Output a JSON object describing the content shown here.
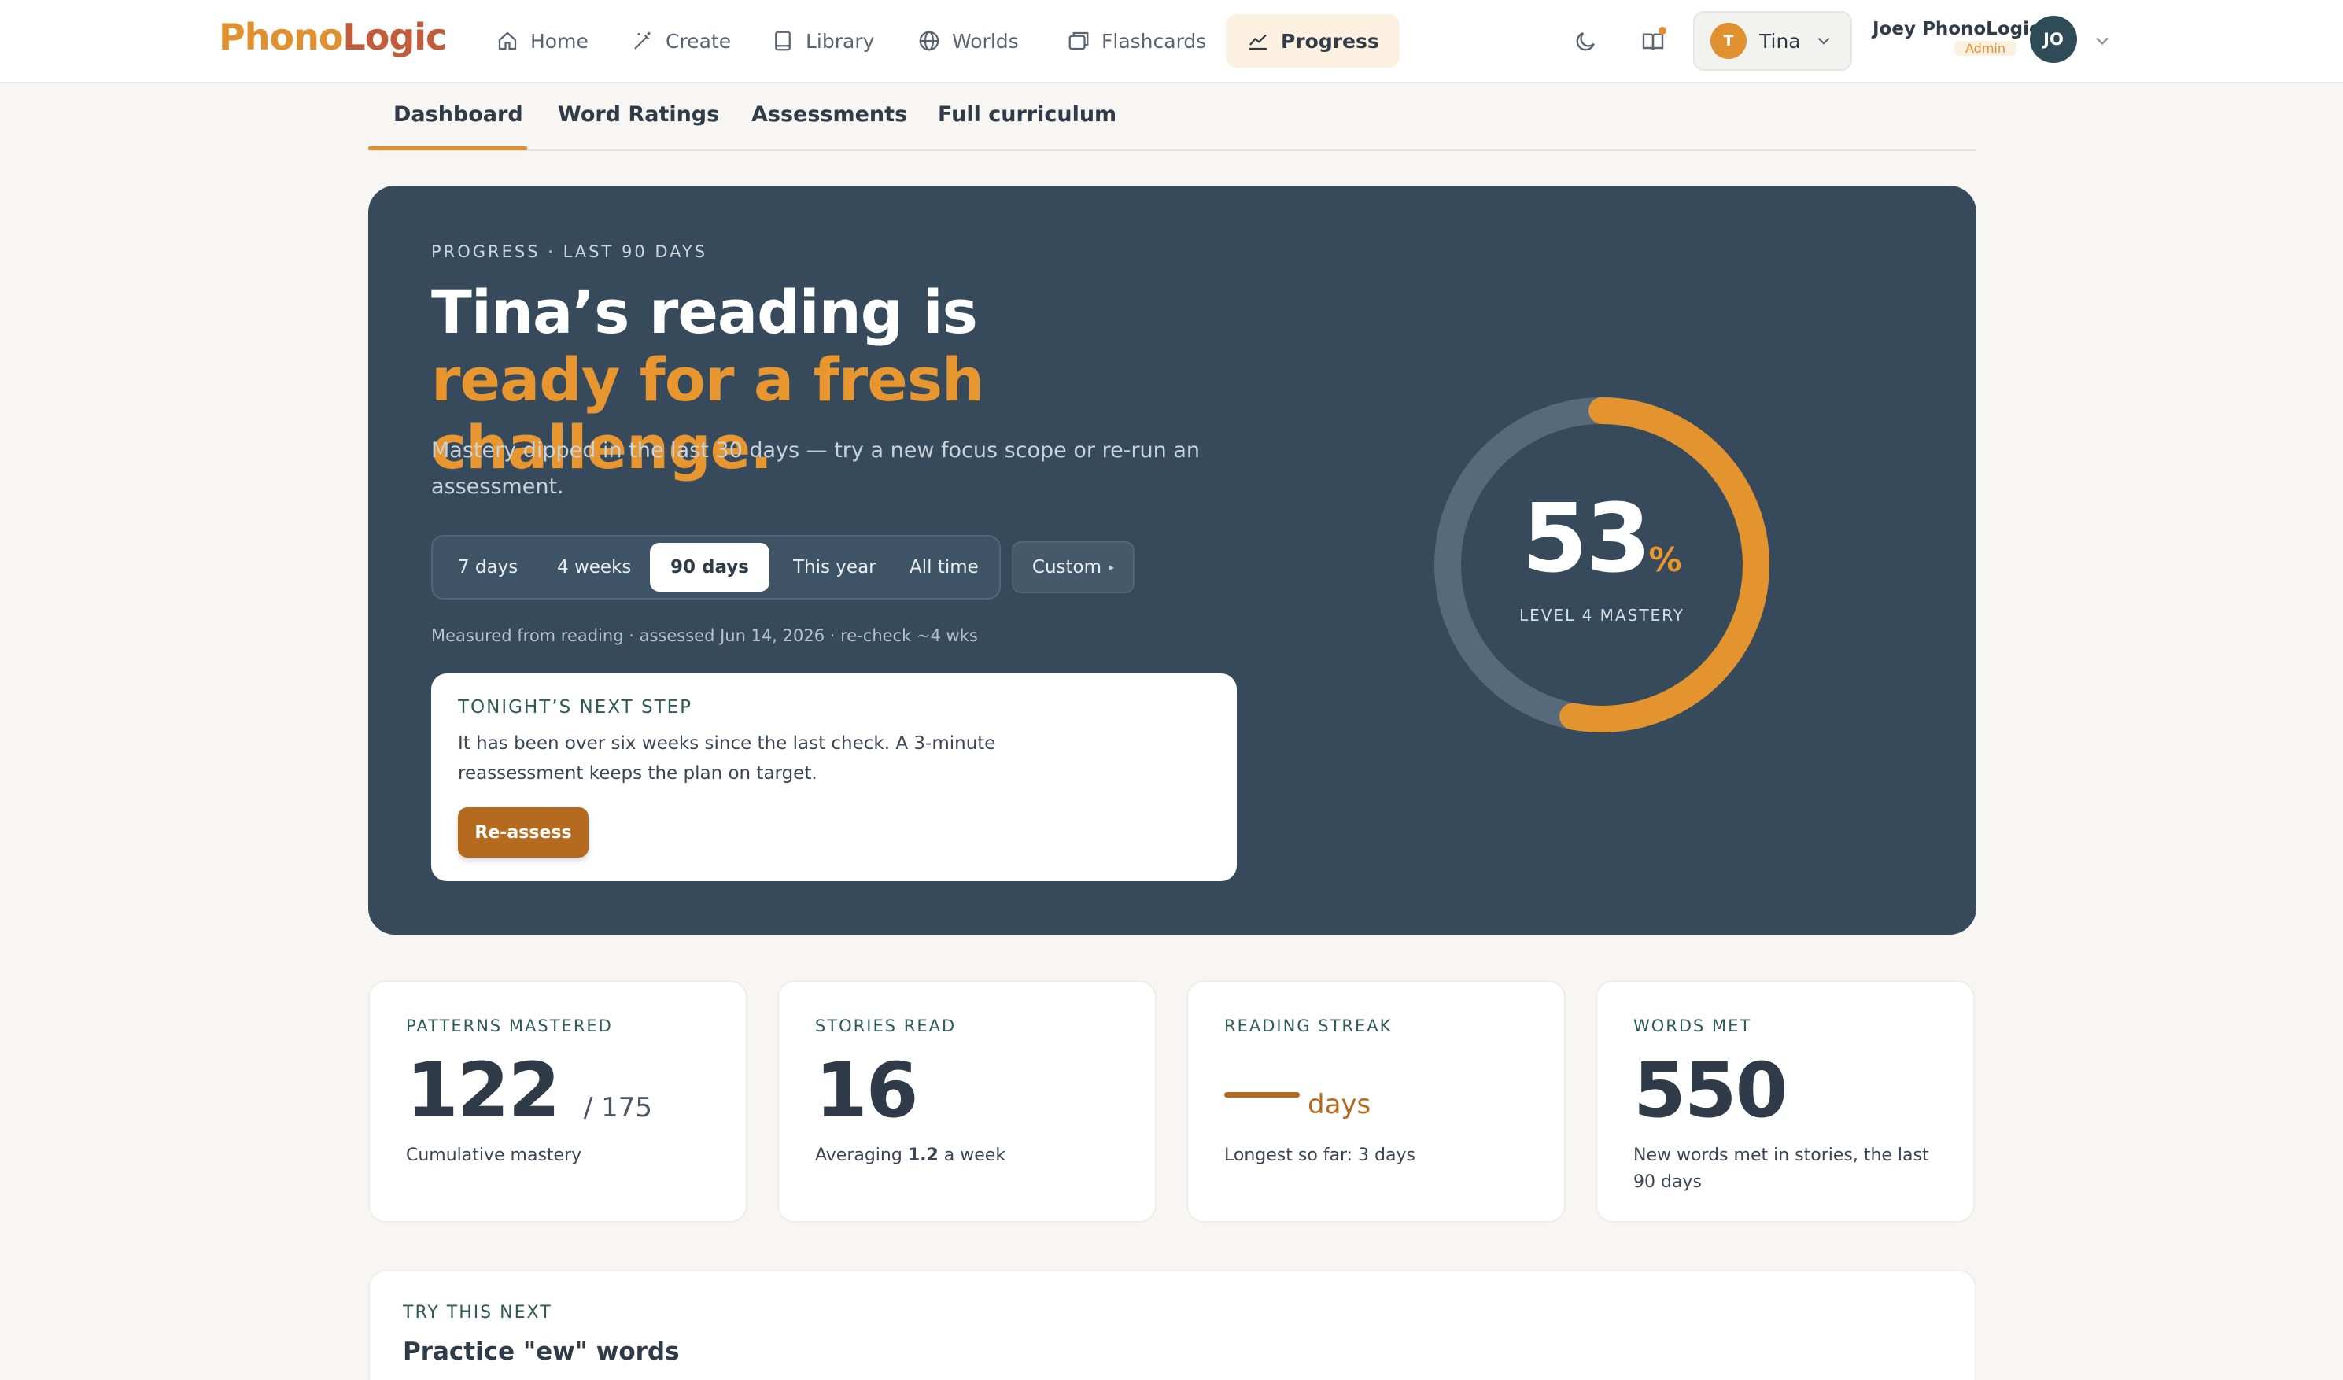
{
  "logo": {
    "part1": "Phono",
    "part2": "Logic"
  },
  "nav": [
    {
      "label": "Home",
      "icon": "home-icon"
    },
    {
      "label": "Create",
      "icon": "wand-icon"
    },
    {
      "label": "Library",
      "icon": "book-icon"
    },
    {
      "label": "Worlds",
      "icon": "globe-icon"
    },
    {
      "label": "Flashcards",
      "icon": "cards-icon"
    },
    {
      "label": "Progress",
      "icon": "chart-icon",
      "active": true
    }
  ],
  "header": {
    "child": {
      "initial": "T",
      "name": "Tina"
    },
    "user": {
      "name": "Joey PhonoLogic",
      "role": "Admin",
      "initials": "JO"
    }
  },
  "subtabs": [
    "Dashboard",
    "Word Ratings",
    "Assessments",
    "Full curriculum"
  ],
  "hero": {
    "eyebrow": "PROGRESS · LAST 90 DAYS",
    "headline_plain": "Tina’s reading is ",
    "headline_highlight": "ready for a fresh challenge.",
    "subtext": "Mastery dipped in the last 30 days — try a new focus scope or re-run an assessment.",
    "ranges": [
      "7 days",
      "4 weeks",
      "90 days",
      "This year",
      "All time"
    ],
    "selected_range": "90 days",
    "custom_label": "Custom",
    "measured": "Measured from reading · assessed Jun 14, 2026 · re-check ~4 wks",
    "next_step": {
      "label": "TONIGHT’S NEXT STEP",
      "body": "It has been over six weeks since the last check. A 3-minute reassessment keeps the plan on target.",
      "button": "Re-assess"
    },
    "mastery": {
      "value": 53,
      "value_text": "53",
      "unit": "%",
      "label": "LEVEL 4 MASTERY"
    }
  },
  "stats": [
    {
      "label": "PATTERNS MASTERED",
      "value": "122",
      "suffix": "/ 175",
      "desc": "Cumulative mastery"
    },
    {
      "label": "STORIES READ",
      "value": "16",
      "desc_pre": "Averaging ",
      "desc_bold": "1.2",
      "desc_post": " a week"
    },
    {
      "label": "READING STREAK",
      "unit": "days",
      "desc": "Longest so far: 3 days"
    },
    {
      "label": "WORDS MET",
      "value": "550",
      "desc": "New words met in stories, the last 90 days"
    }
  ],
  "try_next": {
    "label": "TRY THIS NEXT",
    "title": "Practice \"ew\" words"
  },
  "colors": {
    "accent": "#e0902f",
    "hero_bg": "#364a5c",
    "button": "#b46b1f"
  }
}
